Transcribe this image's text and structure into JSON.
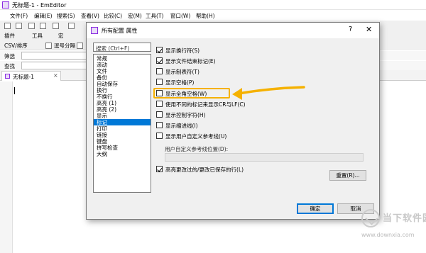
{
  "window": {
    "title": "无标题-1 - EmEditor"
  },
  "menu": [
    "文件(F)",
    "编辑(E)",
    "搜索(S)",
    "查看(V)",
    "比较(C)",
    "宏(M)",
    "工具(T)",
    "窗口(W)",
    "帮助(H)"
  ],
  "toolbar": {
    "plugins_label": "插件",
    "tools_label": "工具",
    "macro_label": "宏",
    "csv_label": "CSV/排序",
    "comma_label": "逗号分隔",
    "tab_label": "标"
  },
  "findbar": {
    "find_label": "筛选",
    "search_label": "查找"
  },
  "doc_tab": {
    "label": "无标题-1",
    "close": "×"
  },
  "dialog": {
    "title": "所有配置 属性",
    "help": "?",
    "close": "✕",
    "search_placeholder": "搜索 (Ctrl+F)",
    "categories": [
      "常规",
      "滚动",
      "文件",
      "备份",
      "自动保存",
      "换行",
      "不换行",
      "高亮 (1)",
      "高亮 (2)",
      "显示",
      "标记",
      "打印",
      "链接",
      "键盘",
      "拼写检查",
      "大纲"
    ],
    "selected_category": "标记",
    "options": [
      {
        "label": "显示换行符(S)",
        "checked": true
      },
      {
        "label": "显示文件结束标记(E)",
        "checked": true
      },
      {
        "label": "显示制表符(T)",
        "checked": false
      },
      {
        "label": "显示空格(P)",
        "checked": false
      },
      {
        "label": "显示全角空格(W)",
        "checked": false
      },
      {
        "label": "使用不同的标记来显示CR与LF(C)",
        "checked": false
      },
      {
        "label": "显示控制字符(H)",
        "checked": false
      },
      {
        "label": "显示缩进线(I)",
        "checked": false
      },
      {
        "label": "显示用户自定义参考线(U)",
        "checked": false
      }
    ],
    "guide_position_label": "用户自定义参考线位置(D):",
    "highlight_changed": {
      "label": "高亮更改过的/更改已保存的行(L)",
      "checked": true
    },
    "reset_button": "重置(R)...",
    "ok_button": "确定",
    "cancel_button": "取消"
  },
  "annotation": {
    "highlight_color": "#f5b100",
    "arrow_color": "#f5b100"
  },
  "watermark": {
    "text": "当下软件园",
    "url": "www.downxia.com"
  }
}
